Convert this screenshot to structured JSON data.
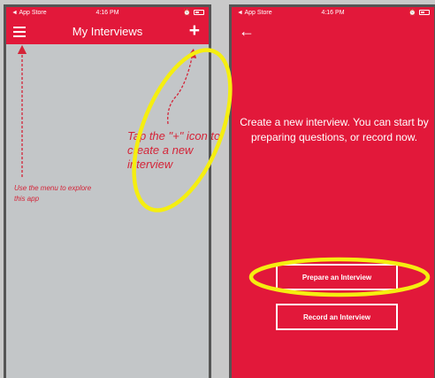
{
  "status": {
    "back_app": "◄ App Store",
    "signal": "📶",
    "time": "4:16 PM"
  },
  "left_screen": {
    "title": "My Interviews",
    "menu_hint": "Use the menu to explore this app",
    "plus_hint": "Tap the \"+\" icon to create a new interview"
  },
  "right_screen": {
    "description": "Create a new interview. You can start by preparing questions, or record now.",
    "prepare_button": "Prepare an Interview",
    "record_button": "Record an Interview"
  },
  "colors": {
    "brand_red": "#e2183a",
    "annotation_red": "#d42438",
    "highlight_yellow": "#f5ee10",
    "list_background": "#c3c6c8"
  },
  "icons": [
    "menu-icon",
    "plus-icon",
    "back-arrow-icon",
    "battery-icon",
    "alarm-icon",
    "wifi-icon"
  ]
}
